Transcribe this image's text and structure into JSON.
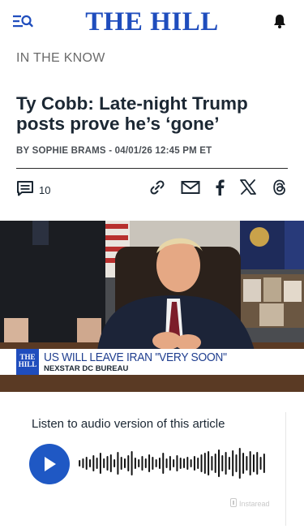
{
  "header": {
    "logo": "THE HILL"
  },
  "article": {
    "section": "IN THE KNOW",
    "headline": "Ty Cobb: Late-night Trump posts prove he’s ‘gone’",
    "byline_prefix": "BY ",
    "author": "SOPHIE BRAMS",
    "byline_sep": " - ",
    "dateline": "04/01/26 12:45 PM ET",
    "comment_count": "10"
  },
  "share": {
    "icons": [
      "link-icon",
      "email-icon",
      "facebook-icon",
      "x-icon",
      "threads-icon"
    ]
  },
  "video": {
    "chyron_logo": "THE HILL",
    "headline": "US WILL LEAVE IRAN \"VERY SOON\"",
    "source": "NEXSTAR DC BUREAU"
  },
  "audio": {
    "title": "Listen to audio version of this article",
    "brand": "Instaread",
    "bars": [
      8,
      12,
      16,
      10,
      20,
      14,
      26,
      12,
      18,
      22,
      10,
      28,
      16,
      12,
      20,
      30,
      14,
      10,
      18,
      12,
      22,
      16,
      10,
      14,
      26,
      12,
      18,
      10,
      20,
      14,
      12,
      16,
      10,
      18,
      14,
      22,
      26,
      30,
      18,
      24,
      34,
      20,
      28,
      16,
      32,
      22,
      38,
      26,
      18,
      30,
      22,
      28,
      16,
      24
    ]
  },
  "colors": {
    "brand": "#1f4dbd",
    "play": "#1f58c4",
    "text": "#1b2733"
  }
}
